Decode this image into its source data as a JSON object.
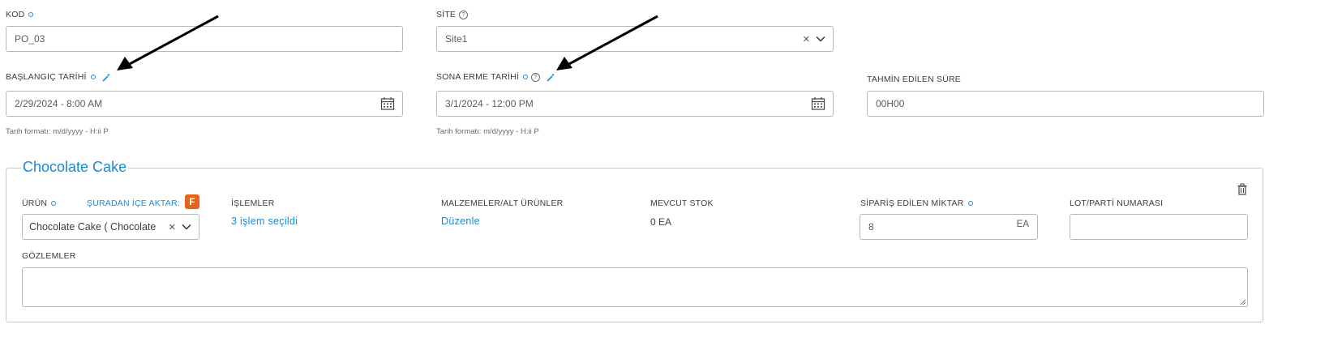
{
  "fields": {
    "kod": {
      "label": "KOD",
      "value": "PO_03"
    },
    "site": {
      "label": "SİTE",
      "value": "Site1"
    },
    "start_date": {
      "label": "BAŞLANGIÇ TARİHİ",
      "value": "2/29/2024 - 8:00 AM",
      "hint": "Tarih formatı: m/d/yyyy - H:ii P"
    },
    "end_date": {
      "label": "SONA ERME TARİHİ",
      "value": "3/1/2024 - 12:00 PM",
      "hint": "Tarih formatı: m/d/yyyy - H:ii P"
    },
    "estimated_duration": {
      "label": "TAHMİN EDİLEN SÜRE",
      "value": "00H00"
    }
  },
  "product_section": {
    "title": "Chocolate Cake",
    "product": {
      "label": "ÜRÜN",
      "import_link": "ŞURADAN İÇE AKTAR:",
      "badge": "F",
      "value": "Chocolate Cake ( Chocolate"
    },
    "operations": {
      "label": "İŞLEMLER",
      "link": "3 işlem seçildi"
    },
    "materials": {
      "label": "MALZEMELER/ALT ÜRÜNLER",
      "link": "Düzenle"
    },
    "stock": {
      "label": "MEVCUT STOK",
      "value": "0 EA"
    },
    "ordered_qty": {
      "label": "SİPARİŞ EDİLEN MİKTAR",
      "value": "8",
      "unit": "EA"
    },
    "lot": {
      "label": "LOT/PARTİ NUMARASI",
      "value": ""
    },
    "notes": {
      "label": "GÖZLEMLER",
      "value": ""
    }
  },
  "colors": {
    "accent": "#1a8ad4",
    "border": "#b8b8b8",
    "badge": "#e8641b"
  }
}
